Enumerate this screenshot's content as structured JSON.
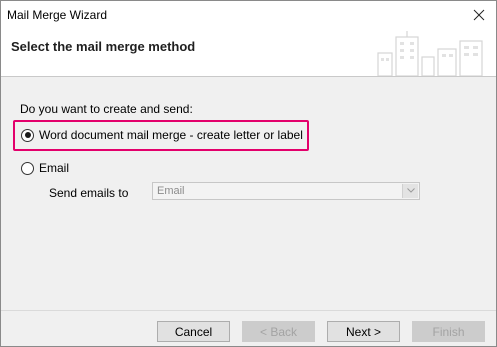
{
  "window": {
    "title": "Mail Merge Wizard"
  },
  "header": {
    "title": "Select the mail merge method"
  },
  "main": {
    "question": "Do you want to create and send:",
    "options": [
      {
        "label": "Word document mail merge - create letter or label",
        "selected": true
      },
      {
        "label": "Email",
        "selected": false
      }
    ],
    "send_emails_label": "Send emails to",
    "send_emails_value": "Email"
  },
  "footer": {
    "cancel": "Cancel",
    "back": "< Back",
    "next": "Next >",
    "finish": "Finish"
  },
  "colors": {
    "highlight": "#e3006b",
    "background": "#f0f0f0"
  }
}
